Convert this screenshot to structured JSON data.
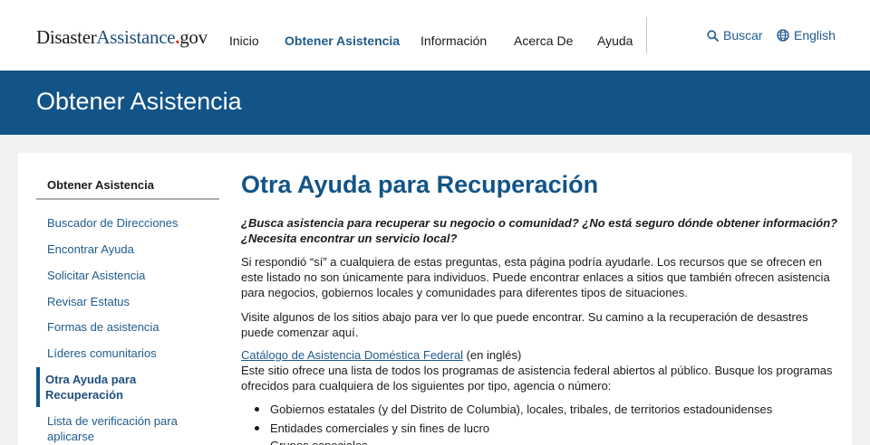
{
  "logo": {
    "part1": "Disaster",
    "part2": "Assistance",
    "dot": ".",
    "part3": "gov"
  },
  "nav": {
    "items": [
      {
        "label": "Inicio"
      },
      {
        "label": "Obtener Asistencia"
      },
      {
        "label": "Información"
      },
      {
        "label": "Acerca De"
      },
      {
        "label": "Ayuda"
      }
    ],
    "active_index": 1
  },
  "utility": {
    "search_label": "Buscar",
    "search_icon": "search-icon",
    "language_label": "English",
    "language_icon": "globe-icon"
  },
  "banner": {
    "title": "Obtener Asistencia"
  },
  "sidebar": {
    "heading": "Obtener Asistencia",
    "items": [
      {
        "lines": [
          "Buscador de Direcciones"
        ]
      },
      {
        "lines": [
          "Encontrar Ayuda"
        ]
      },
      {
        "lines": [
          "Solicitar Asistencia"
        ]
      },
      {
        "lines": [
          "Revisar Estatus"
        ]
      },
      {
        "lines": [
          "Formas de asistencia"
        ]
      },
      {
        "lines": [
          "Líderes comunitarios"
        ]
      },
      {
        "lines": [
          "Otra Ayuda para",
          "Recuperación"
        ]
      },
      {
        "lines": [
          "Lista de verificación para",
          "aplicarse"
        ]
      }
    ],
    "current_index": 6
  },
  "main": {
    "title": "Otra Ayuda para Recuperación",
    "intro": "¿Busca asistencia para recuperar su negocio o comunidad? ¿No está seguro dónde obtener información? ¿Necesita encontrar un servicio local?",
    "para1": "Si respondió “sí” a cualquiera de estas preguntas, esta página podría ayudarle. Los recursos que se ofrecen en este listado no son únicamente para individuos. Puede encontrar enlaces a sitios que también ofrecen asistencia para negocios, gobiernos locales y comunidades para diferentes tipos de situaciones.",
    "para2": "Visite algunos de los sitios abajo para ver lo que puede encontrar. Su camino a la recuperación de desastres puede comenzar aquí.",
    "catalog_link": "Catálogo de Asistencia Doméstica Federal",
    "catalog_note": " (en inglés)",
    "catalog_desc": "Este sitio ofrece una lista de todos los programas de asistencia federal abiertos al público. Busque los programas ofrecidos para cualquiera de los siguientes por tipo, agencia o número:",
    "bullets": [
      "Gobiernos estatales (y del Distrito de Columbia), locales, tribales, de territorios estadounidenses",
      "Entidades comerciales y sin fines de lucro",
      "Grupos especiales"
    ]
  },
  "colors": {
    "brand_blue": "#125488",
    "link_blue": "#1f5b8c",
    "logo_dot_red": "#d6322f"
  }
}
